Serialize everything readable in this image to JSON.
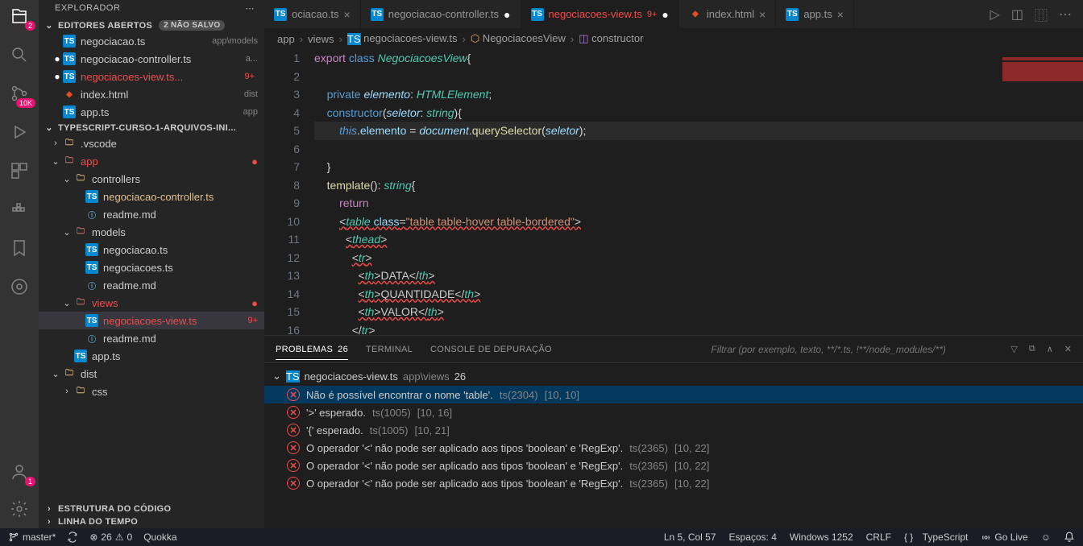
{
  "sidebar": {
    "title": "EXPLORADOR",
    "openEditors": {
      "label": "EDITORES ABERTOS",
      "badge": "2 NÃO SALVO"
    },
    "openItems": [
      {
        "name": "negociacao.ts",
        "hint": "app\\models",
        "icon": "ts"
      },
      {
        "name": "negociacao-controller.ts",
        "hint": "a...",
        "icon": "ts",
        "dirty": true
      },
      {
        "name": "negociacoes-view.ts...",
        "hint": "",
        "icon": "ts",
        "err": true,
        "suffix": "9+",
        "dirty": true
      },
      {
        "name": "index.html",
        "hint": "dist",
        "icon": "html"
      },
      {
        "name": "app.ts",
        "hint": "app",
        "icon": "ts"
      }
    ],
    "project": "TYPESCRIPT-CURSO-1-ARQUIVOS-INI...",
    "tree": [
      {
        "indent": 0,
        "type": "folder",
        "name": ".vscode",
        "open": false,
        "chev": "›"
      },
      {
        "indent": 0,
        "type": "folder-red",
        "name": "app",
        "open": true,
        "err": true,
        "marker": "●"
      },
      {
        "indent": 1,
        "type": "folder",
        "name": "controllers",
        "open": true
      },
      {
        "indent": 2,
        "type": "ts",
        "name": "negociacao-controller.ts",
        "mod": true
      },
      {
        "indent": 2,
        "type": "md",
        "name": "readme.md"
      },
      {
        "indent": 1,
        "type": "folder-red",
        "name": "models",
        "open": true
      },
      {
        "indent": 2,
        "type": "ts",
        "name": "negociacao.ts"
      },
      {
        "indent": 2,
        "type": "ts",
        "name": "negociacoes.ts"
      },
      {
        "indent": 2,
        "type": "md",
        "name": "readme.md"
      },
      {
        "indent": 1,
        "type": "folder-red",
        "name": "views",
        "open": true,
        "err": true,
        "marker": "●"
      },
      {
        "indent": 2,
        "type": "ts",
        "name": "negociacoes-view.ts",
        "err": true,
        "suffix": "9+",
        "selected": true
      },
      {
        "indent": 2,
        "type": "md",
        "name": "readme.md"
      },
      {
        "indent": 1,
        "type": "ts",
        "name": "app.ts"
      },
      {
        "indent": 0,
        "type": "folder",
        "name": "dist",
        "open": true
      },
      {
        "indent": 1,
        "type": "folder",
        "name": "css",
        "open": false,
        "chev": "›"
      }
    ],
    "outline": "ESTRUTURA DO CÓDIGO",
    "timeline": "LINHA DO TEMPO"
  },
  "tabs": [
    {
      "name": "ociacao.ts",
      "icon": "ts"
    },
    {
      "name": "negociacao-controller.ts",
      "icon": "ts",
      "dirty": true
    },
    {
      "name": "negociacoes-view.ts",
      "icon": "ts",
      "err": true,
      "suffix": "9+",
      "dirty": true,
      "active": true
    },
    {
      "name": "index.html",
      "icon": "html"
    },
    {
      "name": "app.ts",
      "icon": "ts"
    }
  ],
  "breadcrumbs": [
    "app",
    "views",
    "negociacoes-view.ts",
    "NegociacoesView",
    "constructor"
  ],
  "code": {
    "lines": [
      {
        "n": 1,
        "html": "<span class='tok-kw'>export</span> <span class='tok-kw2'>class</span> <span class='tok-cls'>NegociacoesView</span><span class='tok-pun'>{</span>"
      },
      {
        "n": 2,
        "html": ""
      },
      {
        "n": 3,
        "html": "    <span class='tok-kw2'>private</span> <span class='tok-var'>elemento</span><span class='tok-pun'>:</span> <span class='tok-type'>HTMLElement</span><span class='tok-pun'>;</span>"
      },
      {
        "n": 4,
        "html": "    <span class='tok-kw2'>constructor</span><span class='tok-pun'>(</span><span class='tok-var'>seletor</span><span class='tok-pun'>:</span> <span class='tok-type'>string</span><span class='tok-pun'>){</span>"
      },
      {
        "n": 5,
        "html": "        <span class='tok-this'>this</span><span class='tok-pun'>.</span><span class='tok-prop'>elemento</span> <span class='tok-pun'>=</span> <span class='tok-var'>document</span><span class='tok-pun'>.</span><span class='tok-fn'>querySelector</span><span class='tok-pun'>(</span><span class='tok-var'>seletor</span><span class='tok-pun'>);</span>",
        "hl": true
      },
      {
        "n": 6,
        "html": "    "
      },
      {
        "n": 7,
        "html": "    <span class='tok-pun'>}</span>"
      },
      {
        "n": 8,
        "html": "    <span class='tok-fn'>template</span><span class='tok-pun'>():</span> <span class='tok-type'>string</span><span class='tok-pun'>{</span>"
      },
      {
        "n": 9,
        "html": "        <span class='tok-kw'>return</span>"
      },
      {
        "n": 10,
        "html": "        <span class='err-underline'>&lt;<span class='tok-tag'>table</span> <span class='tok-prop'>class</span>=<span class='tok-str'>\"table table-hover table-bordered\"</span>&gt;</span>"
      },
      {
        "n": 11,
        "html": "          <span class='err-underline'>&lt;<span class='tok-tag'>thead</span>&gt;</span>"
      },
      {
        "n": 12,
        "html": "            <span class='err-underline'>&lt;<span class='tok-tag'>tr</span>&gt;</span>"
      },
      {
        "n": 13,
        "html": "              <span class='err-underline'>&lt;<span class='tok-tag'>th</span>&gt;DATA&lt;/<span class='tok-tag'>th</span>&gt;</span>"
      },
      {
        "n": 14,
        "html": "              <span class='err-underline'>&lt;<span class='tok-tag'>th</span>&gt;QUANTIDADE&lt;/<span class='tok-tag'>th</span>&gt;</span>"
      },
      {
        "n": 15,
        "html": "              <span class='err-underline'>&lt;<span class='tok-tag'>th</span>&gt;VALOR&lt;/<span class='tok-tag'>th</span>&gt;</span>"
      },
      {
        "n": 16,
        "html": "            <span class='err-underline'>&lt;/<span class='tok-tag'>tr</span>&gt;</span>"
      }
    ]
  },
  "panel": {
    "tabs": {
      "problems": "PROBLEMAS",
      "problemsCount": "26",
      "terminal": "TERMINAL",
      "debug": "CONSOLE DE DEPURAÇÃO"
    },
    "filterPlaceholder": "Filtrar (por exemplo, texto, **/*.ts, !**/node_modules/**)",
    "fileHead": {
      "name": "negociacoes-view.ts",
      "hint": "app\\views",
      "count": "26"
    },
    "errors": [
      {
        "msg": "Não é possível encontrar o nome 'table'.",
        "code": "ts(2304)",
        "loc": "[10, 10]",
        "sel": true
      },
      {
        "msg": "'>' esperado.",
        "code": "ts(1005)",
        "loc": "[10, 16]"
      },
      {
        "msg": "'{' esperado.",
        "code": "ts(1005)",
        "loc": "[10, 21]"
      },
      {
        "msg": "O operador '<' não pode ser aplicado aos tipos 'boolean' e 'RegExp'.",
        "code": "ts(2365)",
        "loc": "[10, 22]"
      },
      {
        "msg": "O operador '<' não pode ser aplicado aos tipos 'boolean' e 'RegExp'.",
        "code": "ts(2365)",
        "loc": "[10, 22]"
      },
      {
        "msg": "O operador '<' não pode ser aplicado aos tipos 'boolean' e 'RegExp'.",
        "code": "ts(2365)",
        "loc": "[10, 22]"
      }
    ]
  },
  "statusbar": {
    "branch": "master*",
    "errors": "26",
    "warnings": "0",
    "quokka": "Quokka",
    "pos": "Ln 5, Col 57",
    "spaces": "Espaços: 4",
    "encoding": "Windows 1252",
    "eol": "CRLF",
    "lang": "TypeScript",
    "golive": "Go Live"
  },
  "activityBadges": {
    "explorer": "2",
    "scm": "10K",
    "account": "1"
  }
}
